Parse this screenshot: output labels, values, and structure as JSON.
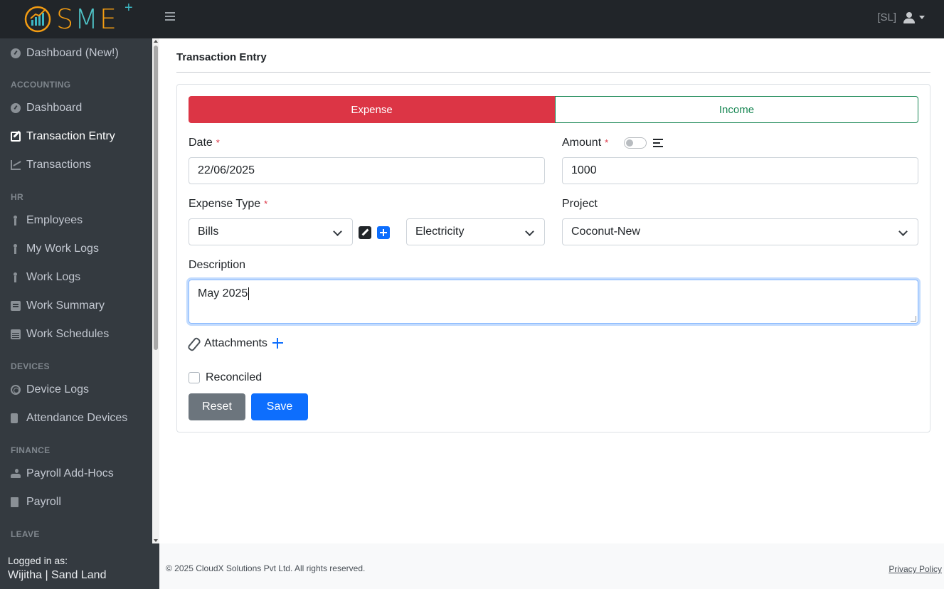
{
  "header": {
    "logo_text_s": "S",
    "logo_text_m": "M",
    "logo_text_e": "E",
    "logo_plus": "+",
    "user_code": "[SL]"
  },
  "sidebar": {
    "items": [
      {
        "label": "Dashboard (New!)",
        "icon": "dashboard-icon"
      },
      {
        "section": "ACCOUNTING"
      },
      {
        "label": "Dashboard",
        "icon": "dashboard-icon"
      },
      {
        "label": "Transaction Entry",
        "icon": "edit-icon",
        "active": true
      },
      {
        "label": "Transactions",
        "icon": "chart-line-icon"
      },
      {
        "section": "HR"
      },
      {
        "label": "Employees",
        "icon": "person-icon"
      },
      {
        "label": "My Work Logs",
        "icon": "walking-icon"
      },
      {
        "label": "Work Logs",
        "icon": "walking-icon"
      },
      {
        "label": "Work Summary",
        "icon": "clipboard-icon"
      },
      {
        "label": "Work Schedules",
        "icon": "calendar-icon"
      },
      {
        "section": "DEVICES"
      },
      {
        "label": "Device Logs",
        "icon": "fingerprint-icon"
      },
      {
        "label": "Attendance Devices",
        "icon": "device-icon"
      },
      {
        "section": "FINANCE"
      },
      {
        "label": "Payroll Add-Hocs",
        "icon": "hand-holding-icon"
      },
      {
        "label": "Payroll",
        "icon": "file-invoice-icon"
      },
      {
        "section": "LEAVE"
      }
    ],
    "logged_label": "Logged in as:",
    "logged_user": "Wijitha | Sand Land"
  },
  "main": {
    "title": "Transaction Entry",
    "tabs": {
      "expense": "Expense",
      "income": "Income"
    },
    "date": {
      "label": "Date",
      "required": "*",
      "value": "22/06/2025"
    },
    "amount": {
      "label": "Amount",
      "required": "*",
      "value": "1000"
    },
    "expense_type": {
      "label": "Expense Type",
      "required": "*",
      "value": "Bills",
      "sub_value": "Electricity"
    },
    "project": {
      "label": "Project",
      "value": "Coconut-New"
    },
    "description": {
      "label": "Description",
      "value": "May 2025"
    },
    "attachments": {
      "label": "Attachments"
    },
    "reconciled": {
      "label": "Reconciled",
      "checked": false
    },
    "buttons": {
      "reset": "Reset",
      "save": "Save"
    }
  },
  "footer": {
    "copyright": "© 2025 CloudX Solutions Pvt Ltd. All rights reserved.",
    "privacy": "Privacy Policy"
  },
  "colors": {
    "expense": "#dc3545",
    "income": "#198754",
    "primary": "#0d6efd",
    "secondary": "#6c757d",
    "sidebar_bg": "#343a40",
    "topbar_bg": "#212529"
  }
}
